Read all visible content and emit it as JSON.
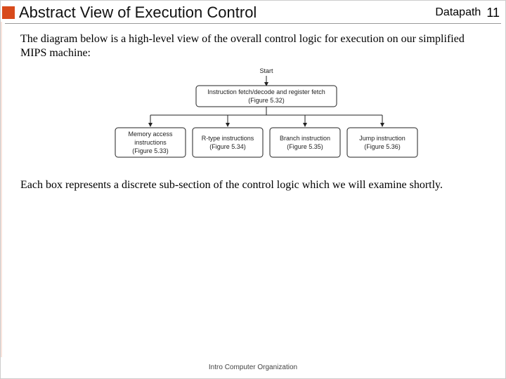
{
  "header": {
    "title": "Abstract View of Execution Control",
    "section": "Datapath",
    "page": "11"
  },
  "body": {
    "intro": "The diagram below is a high-level view of the overall control logic for execution on our simplified MIPS machine:",
    "outro": "Each box represents a discrete sub-section of the control logic which we will examine shortly."
  },
  "diagram": {
    "start": "Start",
    "root_l1": "Instruction fetch/decode and register fetch",
    "root_l2": "(Figure 5.32)",
    "boxes": [
      {
        "l1": "Memory access",
        "l2": "instructions",
        "l3": "(Figure 5.33)"
      },
      {
        "l1": "R-type instructions",
        "l2": "(Figure 5.34)",
        "l3": ""
      },
      {
        "l1": "Branch instruction",
        "l2": "(Figure 5.35)",
        "l3": ""
      },
      {
        "l1": "Jump instruction",
        "l2": "(Figure 5.36)",
        "l3": ""
      }
    ]
  },
  "footer": "Intro Computer Organization"
}
